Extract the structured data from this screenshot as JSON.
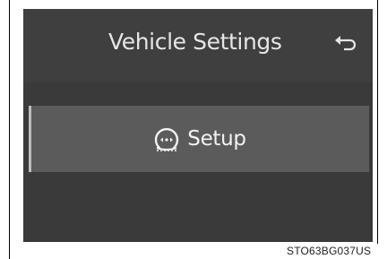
{
  "header": {
    "title": "Vehicle Settings",
    "back_icon": "back-arrow-icon"
  },
  "menu": {
    "items": [
      {
        "label": "Setup",
        "icon": "tire-pressure-icon"
      }
    ]
  },
  "figure_code": "STO63BG037US",
  "colors": {
    "screen_bg": "#3a3a3a",
    "header_bg": "#3f3f3f",
    "row_bg": "#5b5b5b",
    "text": "#e6e6e6"
  }
}
